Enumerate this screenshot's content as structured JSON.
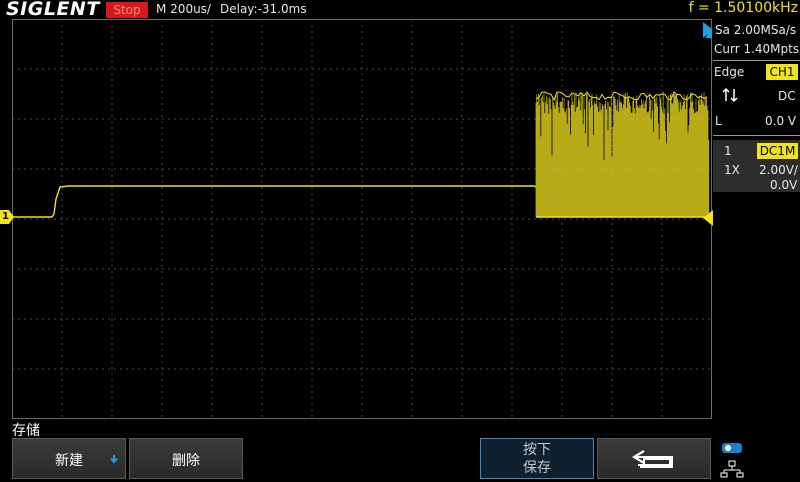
{
  "topbar": {
    "brand": "SIGLENT",
    "run_status": "Stop",
    "timebase": "M 200us/",
    "delay": "Delay:-31.0ms",
    "frequency": "f = 1.50100kHz"
  },
  "acquisition": {
    "sample_rate": "Sa 2.00MSa/s",
    "memory_depth": "Curr 1.40Mpts"
  },
  "trigger": {
    "type": "Edge",
    "source": "CH1",
    "slope_icon": "slope-either-icon",
    "coupling": "DC",
    "level_label": "L",
    "level": "0.0 V"
  },
  "channel1": {
    "number": "1",
    "coupling": "DC1M",
    "probe": "1X",
    "scale": "2.00V/",
    "offset": "0.0V",
    "marker": "1"
  },
  "colors": {
    "trace": "#f1e31c",
    "stop": "#d61a1a",
    "trigger_marker": "#1e9fe0",
    "grid": "#5a5a5a"
  },
  "menu": {
    "title": "存储",
    "buttons": [
      {
        "label": "新建"
      },
      {
        "label": "删除"
      },
      {
        "label_line1": "按下",
        "label_line2": "保存"
      },
      {
        "icon": "return-arrow-icon"
      },
      {
        "icon": "network-status-icon"
      }
    ]
  }
}
